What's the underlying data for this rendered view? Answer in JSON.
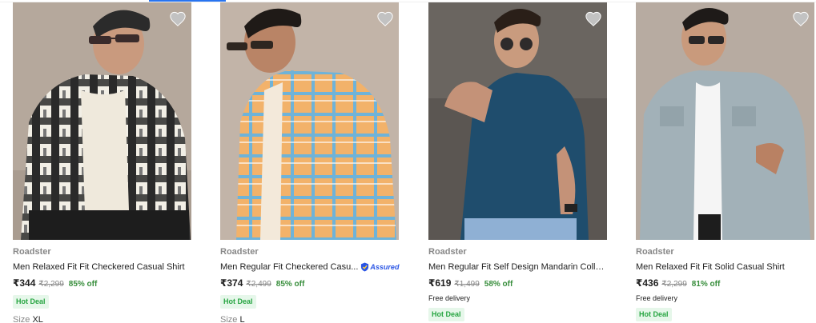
{
  "colors": {
    "accent": "#2874f0",
    "discount": "#388e3c",
    "deal_bg": "#e6f7ea",
    "deal_text": "#26a541",
    "muted": "#878787"
  },
  "products": [
    {
      "brand": "Roadster",
      "title": "Men Relaxed Fit Fit Checkered Casual Shirt",
      "price": "₹344",
      "mrp": "₹2,299",
      "discount": "85% off",
      "deal": "Hot Deal",
      "size_label": "Size",
      "size_value": "XL",
      "icon": "heart-icon"
    },
    {
      "brand": "Roadster",
      "title": "Men Regular Fit Checkered Casu...",
      "assured": "Assured",
      "price": "₹374",
      "mrp": "₹2,499",
      "discount": "85% off",
      "deal": "Hot Deal",
      "size_label": "Size",
      "size_value": "L",
      "icon": "heart-icon"
    },
    {
      "brand": "Roadster",
      "title": "Men Regular Fit Self Design Mandarin Collar ...",
      "price": "₹619",
      "mrp": "₹1,499",
      "discount": "58% off",
      "delivery": "Free delivery",
      "deal": "Hot Deal",
      "icon": "heart-icon"
    },
    {
      "brand": "Roadster",
      "title": "Men Relaxed Fit Fit Solid Casual Shirt",
      "price": "₹436",
      "mrp": "₹2,299",
      "discount": "81% off",
      "delivery": "Free delivery",
      "deal": "Hot Deal",
      "icon": "heart-icon"
    }
  ]
}
